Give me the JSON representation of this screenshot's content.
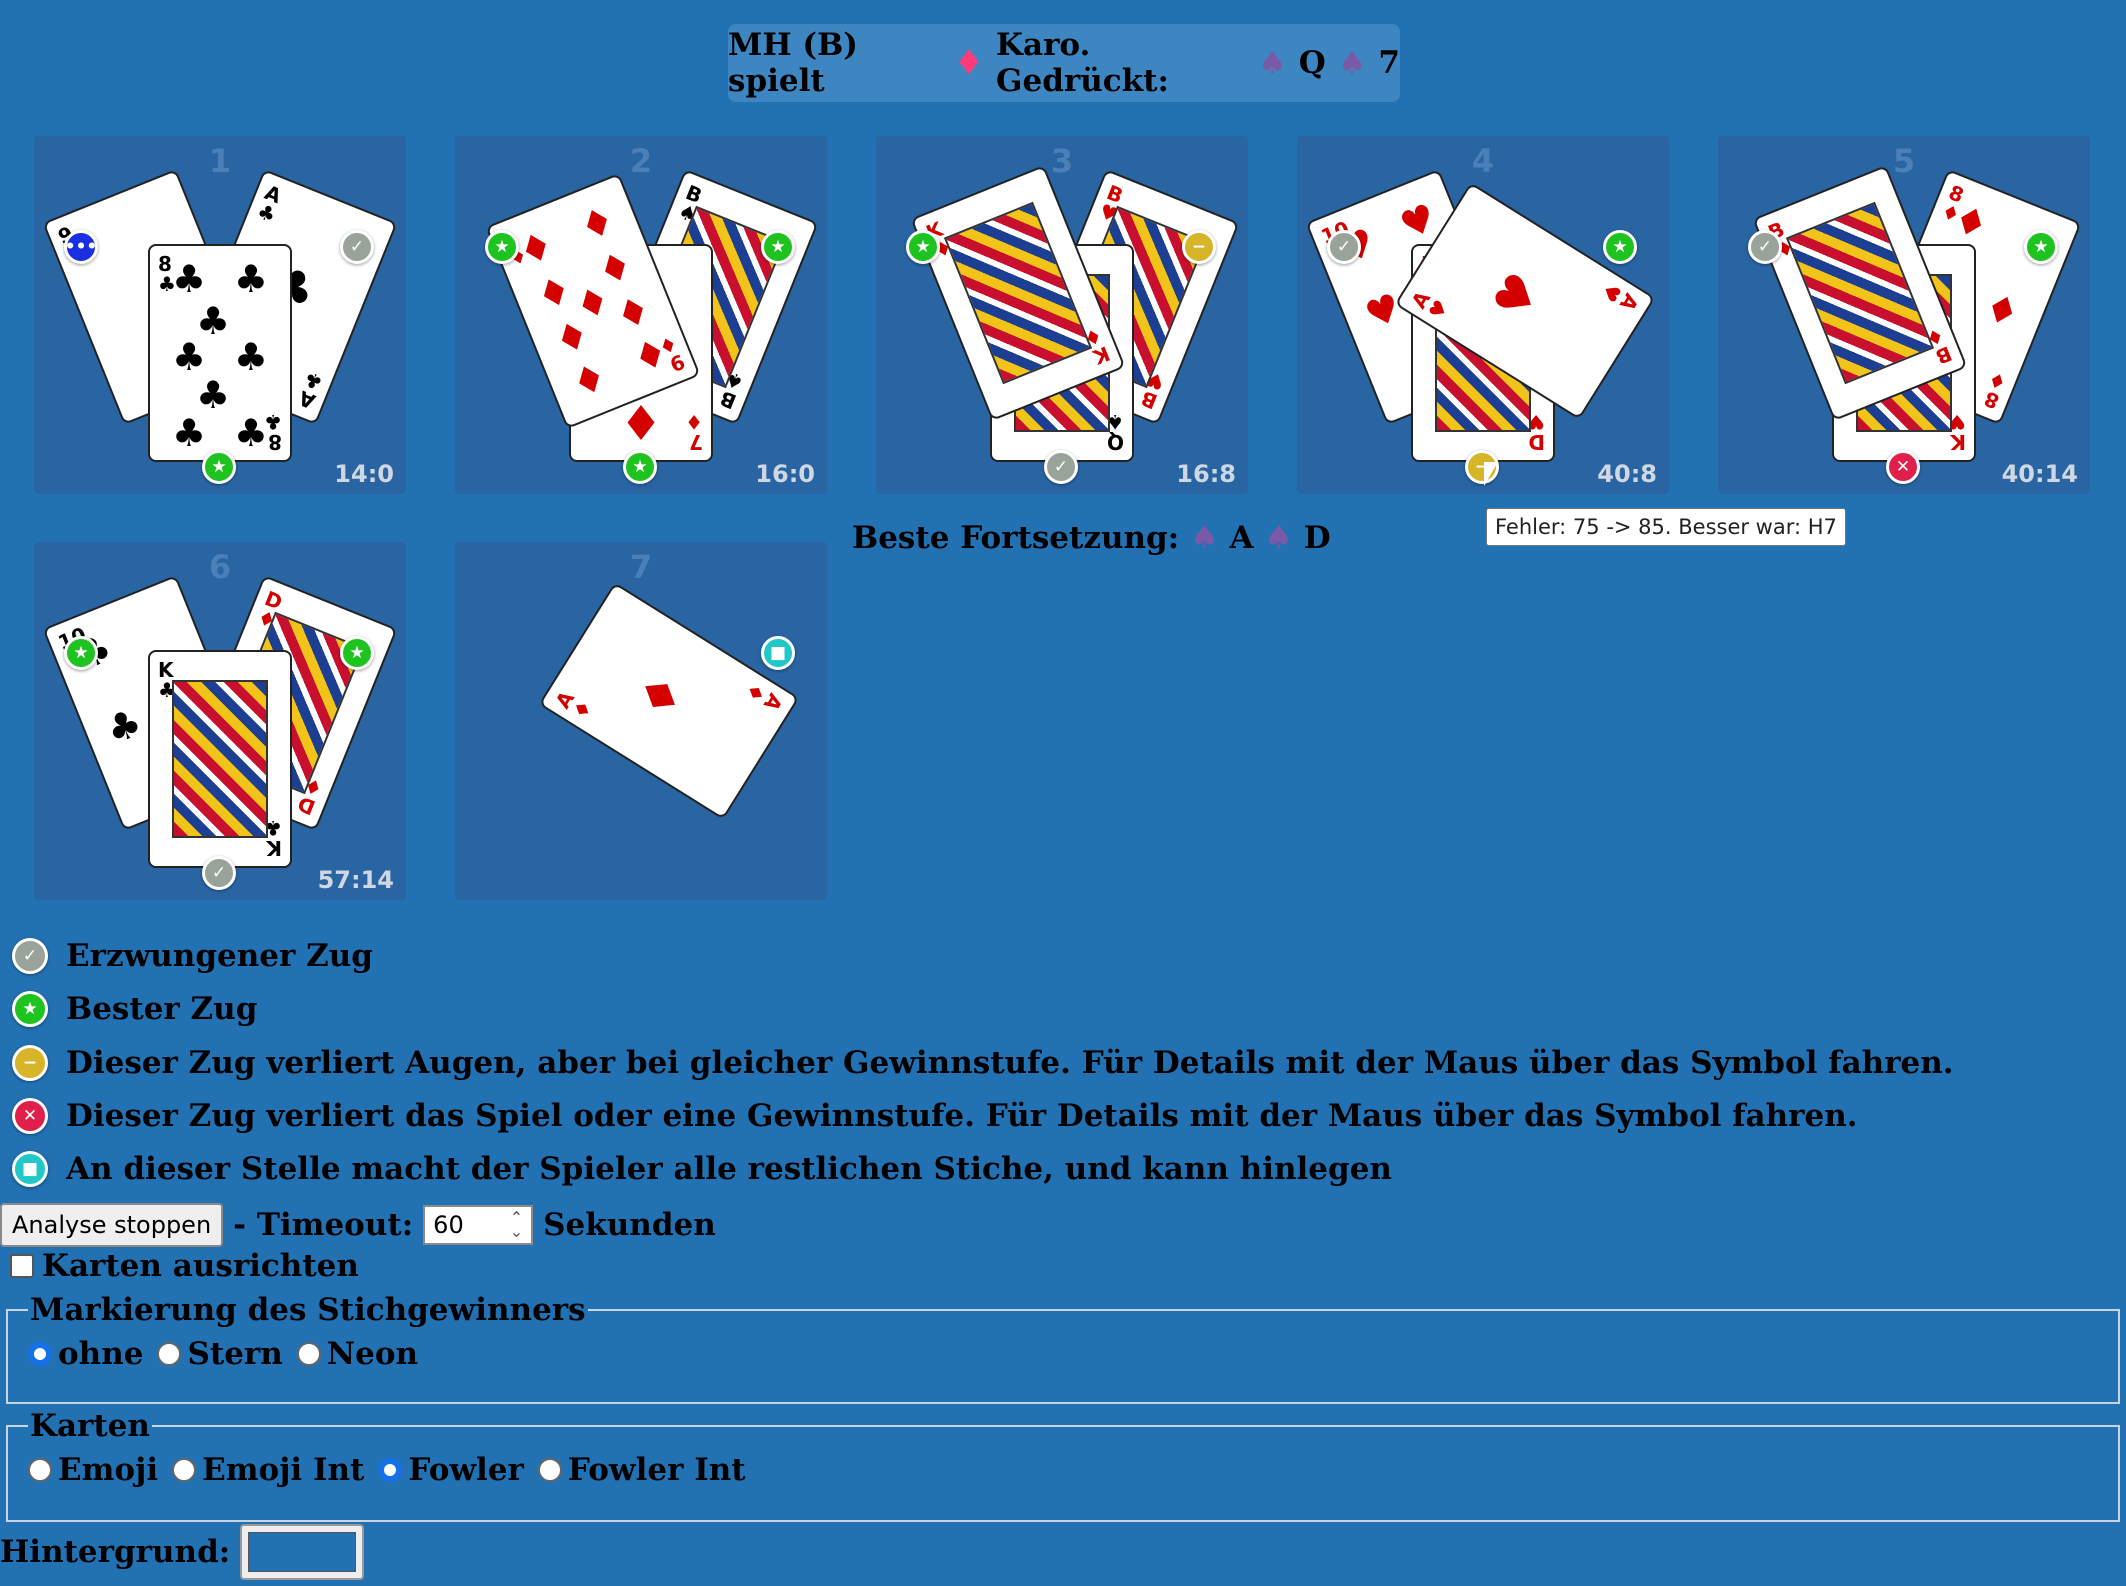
{
  "header": {
    "prefix": "MH (B) spielt",
    "trump_symbol": "♦",
    "trump_name": "Karo. Gedrückt:",
    "pressed": [
      {
        "suit": "♠",
        "rank": "Q"
      },
      {
        "suit": "♠",
        "rank": "7"
      }
    ]
  },
  "tricks": [
    {
      "number": "1",
      "score": "14:0"
    },
    {
      "number": "2",
      "score": "16:0"
    },
    {
      "number": "3",
      "score": "16:8"
    },
    {
      "number": "4",
      "score": "40:8"
    },
    {
      "number": "5",
      "score": "40:14"
    },
    {
      "number": "6",
      "score": "57:14"
    },
    {
      "number": "7",
      "score": ""
    }
  ],
  "best_continuation": {
    "label": "Beste Fortsetzung:",
    "cards": [
      {
        "suit": "♠",
        "rank": "A"
      },
      {
        "suit": "♠",
        "rank": "D"
      }
    ]
  },
  "tooltip": "Fehler: 75 -> 85. Besser war: H7",
  "legend": [
    {
      "icon": "check-icon",
      "text": "Erzwungener Zug"
    },
    {
      "icon": "star-icon",
      "text": "Bester Zug"
    },
    {
      "icon": "minus-icon",
      "text": "Dieser Zug verliert Augen, aber bei gleicher Gewinnstufe. Für Details mit der Maus über das Symbol fahren."
    },
    {
      "icon": "x-icon",
      "text": "Dieser Zug verliert das Spiel oder eine Gewinnstufe. Für Details mit der Maus über das Symbol fahren."
    },
    {
      "icon": "square-icon",
      "text": "An dieser Stelle macht der Spieler alle restlichen Stiche, und kann hinlegen"
    }
  ],
  "controls": {
    "stop_button": "Analyse stoppen",
    "timeout_label": "- Timeout:",
    "timeout_value": "60",
    "seconds_label": "Sekunden",
    "align_label": "Karten ausrichten"
  },
  "marking": {
    "legend": "Markierung des Stichgewinners",
    "options": [
      "ohne",
      "Stern",
      "Neon"
    ],
    "selected": "ohne"
  },
  "cards_style": {
    "legend": "Karten",
    "options": [
      "Emoji",
      "Emoji Int",
      "Fowler",
      "Fowler Int"
    ],
    "selected": "Fowler"
  },
  "background": {
    "label": "Hintergrund:",
    "color": "#2271b3"
  },
  "colors": {
    "page_bg": "#2271b3",
    "trick_bg": "#2a65a3",
    "badge_green": "#1fc31f",
    "badge_gray": "#9aa39a",
    "badge_yellow": "#d6b528",
    "badge_red": "#e0204a",
    "badge_blue": "#1a2fe0",
    "badge_cyan": "#22c8c8"
  }
}
